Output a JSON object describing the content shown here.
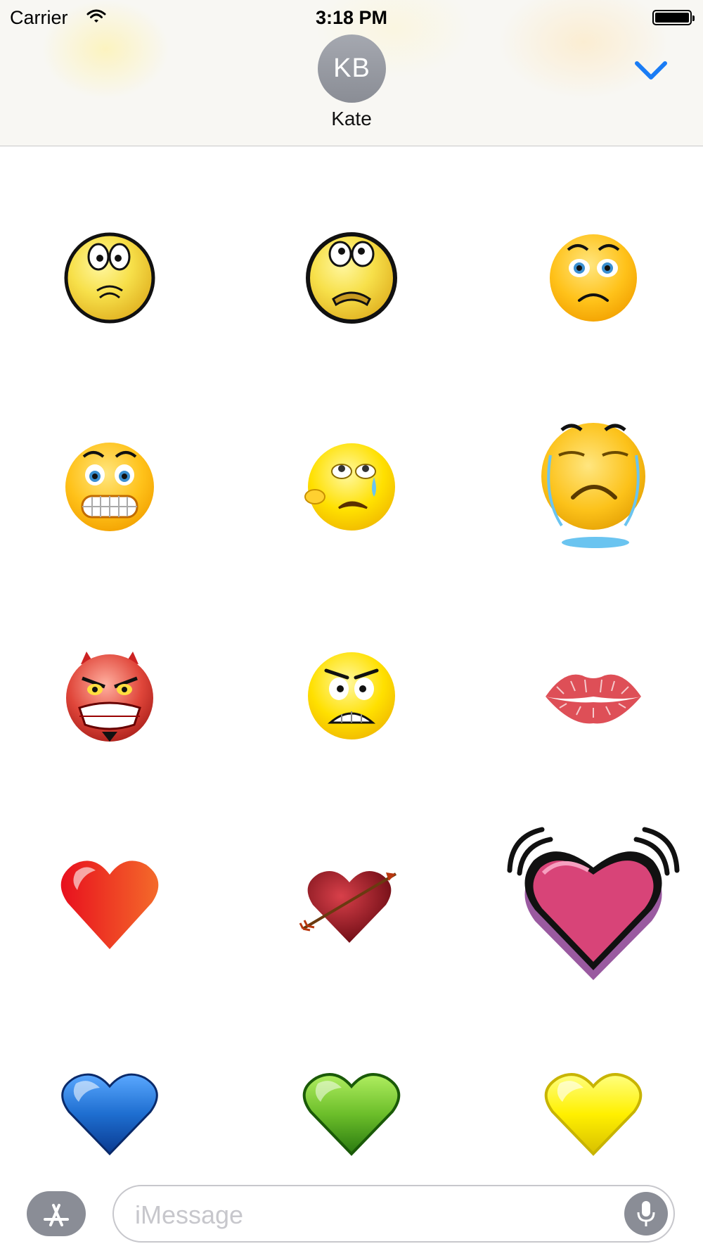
{
  "status_bar": {
    "carrier": "Carrier",
    "time": "3:18 PM"
  },
  "conversation": {
    "initials": "KB",
    "name": "Kate"
  },
  "composer": {
    "placeholder": "iMessage"
  },
  "stickers": [
    "worried-face",
    "fearful-face",
    "sad-face",
    "grimacing-face",
    "crying-face",
    "sobbing-face",
    "devil-face",
    "angry-face",
    "kiss-lips",
    "red-heart",
    "heart-with-arrow",
    "vibrating-pink-heart",
    "blue-heart",
    "green-heart",
    "yellow-heart"
  ],
  "colors": {
    "accent": "#1a7cf5",
    "avatar": "#9a9da5"
  }
}
